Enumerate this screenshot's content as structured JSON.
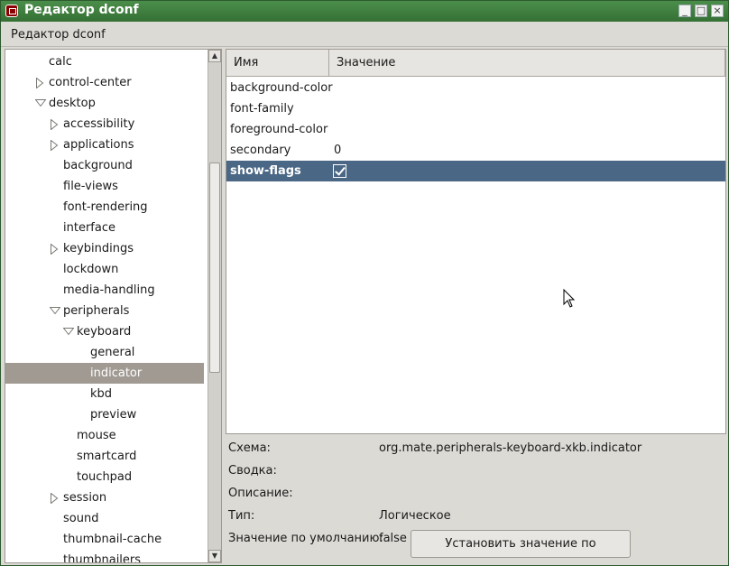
{
  "window": {
    "title": "Редактор dconf",
    "controls": {
      "minimize": "_",
      "maximize": "□",
      "close": "×"
    }
  },
  "menubar": {
    "items": [
      "Редактор dconf"
    ]
  },
  "tree": {
    "items": [
      {
        "label": "calc",
        "expander": "none",
        "depth": 1
      },
      {
        "label": "control-center",
        "expander": "collapsed",
        "depth": 1
      },
      {
        "label": "desktop",
        "expander": "expanded",
        "depth": 1
      },
      {
        "label": "accessibility",
        "expander": "collapsed",
        "depth": 2
      },
      {
        "label": "applications",
        "expander": "collapsed",
        "depth": 2
      },
      {
        "label": "background",
        "expander": "none",
        "depth": 2
      },
      {
        "label": "file-views",
        "expander": "none",
        "depth": 2
      },
      {
        "label": "font-rendering",
        "expander": "none",
        "depth": 2
      },
      {
        "label": "interface",
        "expander": "none",
        "depth": 2
      },
      {
        "label": "keybindings",
        "expander": "collapsed",
        "depth": 2
      },
      {
        "label": "lockdown",
        "expander": "none",
        "depth": 2
      },
      {
        "label": "media-handling",
        "expander": "none",
        "depth": 2
      },
      {
        "label": "peripherals",
        "expander": "expanded",
        "depth": 2
      },
      {
        "label": "keyboard",
        "expander": "expanded",
        "depth": 3
      },
      {
        "label": "general",
        "expander": "none",
        "depth": 4
      },
      {
        "label": "indicator",
        "expander": "none",
        "depth": 4,
        "selected": true
      },
      {
        "label": "kbd",
        "expander": "none",
        "depth": 4
      },
      {
        "label": "preview",
        "expander": "none",
        "depth": 4
      },
      {
        "label": "mouse",
        "expander": "none",
        "depth": 3
      },
      {
        "label": "smartcard",
        "expander": "none",
        "depth": 3
      },
      {
        "label": "touchpad",
        "expander": "none",
        "depth": 3
      },
      {
        "label": "session",
        "expander": "collapsed",
        "depth": 2
      },
      {
        "label": "sound",
        "expander": "none",
        "depth": 2
      },
      {
        "label": "thumbnail-cache",
        "expander": "none",
        "depth": 2
      },
      {
        "label": "thumbnailers",
        "expander": "none",
        "depth": 2
      }
    ]
  },
  "keys": {
    "columns": {
      "name": "Имя",
      "value": "Значение"
    },
    "rows": [
      {
        "name": "background-color",
        "value": ""
      },
      {
        "name": "font-family",
        "value": ""
      },
      {
        "name": "foreground-color",
        "value": ""
      },
      {
        "name": "secondary",
        "value": "0"
      },
      {
        "name": "show-flags",
        "value": "",
        "checked": true,
        "selected": true
      }
    ]
  },
  "details": {
    "schema_label": "Схема:",
    "schema_value": "org.mate.peripherals-keyboard-xkb.indicator",
    "summary_label": "Сводка:",
    "description_label": "Описание:",
    "type_label": "Тип:",
    "type_value": "Логическое",
    "default_label": "Значение по умолчанию:",
    "default_value": "false",
    "set_default_button": "Установить значение по умолчанию"
  },
  "colors": {
    "titlebar": "#3f7f3f",
    "tree_selection": "#a09a93",
    "key_selection": "#4a6785",
    "window_bg": "#dcdad5"
  }
}
